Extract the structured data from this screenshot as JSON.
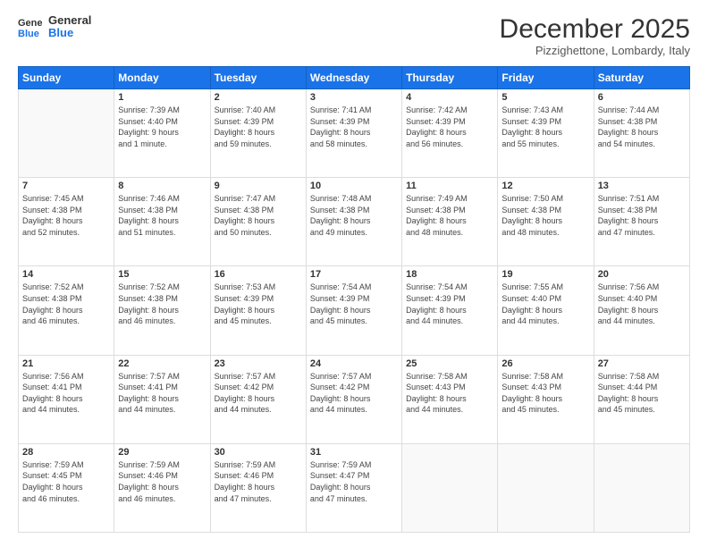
{
  "header": {
    "logo_line1": "General",
    "logo_line2": "Blue",
    "month_title": "December 2025",
    "subtitle": "Pizzighettone, Lombardy, Italy"
  },
  "days_of_week": [
    "Sunday",
    "Monday",
    "Tuesday",
    "Wednesday",
    "Thursday",
    "Friday",
    "Saturday"
  ],
  "weeks": [
    [
      {
        "num": "",
        "info": ""
      },
      {
        "num": "1",
        "info": "Sunrise: 7:39 AM\nSunset: 4:40 PM\nDaylight: 9 hours\nand 1 minute."
      },
      {
        "num": "2",
        "info": "Sunrise: 7:40 AM\nSunset: 4:39 PM\nDaylight: 8 hours\nand 59 minutes."
      },
      {
        "num": "3",
        "info": "Sunrise: 7:41 AM\nSunset: 4:39 PM\nDaylight: 8 hours\nand 58 minutes."
      },
      {
        "num": "4",
        "info": "Sunrise: 7:42 AM\nSunset: 4:39 PM\nDaylight: 8 hours\nand 56 minutes."
      },
      {
        "num": "5",
        "info": "Sunrise: 7:43 AM\nSunset: 4:39 PM\nDaylight: 8 hours\nand 55 minutes."
      },
      {
        "num": "6",
        "info": "Sunrise: 7:44 AM\nSunset: 4:38 PM\nDaylight: 8 hours\nand 54 minutes."
      }
    ],
    [
      {
        "num": "7",
        "info": "Sunrise: 7:45 AM\nSunset: 4:38 PM\nDaylight: 8 hours\nand 52 minutes."
      },
      {
        "num": "8",
        "info": "Sunrise: 7:46 AM\nSunset: 4:38 PM\nDaylight: 8 hours\nand 51 minutes."
      },
      {
        "num": "9",
        "info": "Sunrise: 7:47 AM\nSunset: 4:38 PM\nDaylight: 8 hours\nand 50 minutes."
      },
      {
        "num": "10",
        "info": "Sunrise: 7:48 AM\nSunset: 4:38 PM\nDaylight: 8 hours\nand 49 minutes."
      },
      {
        "num": "11",
        "info": "Sunrise: 7:49 AM\nSunset: 4:38 PM\nDaylight: 8 hours\nand 48 minutes."
      },
      {
        "num": "12",
        "info": "Sunrise: 7:50 AM\nSunset: 4:38 PM\nDaylight: 8 hours\nand 48 minutes."
      },
      {
        "num": "13",
        "info": "Sunrise: 7:51 AM\nSunset: 4:38 PM\nDaylight: 8 hours\nand 47 minutes."
      }
    ],
    [
      {
        "num": "14",
        "info": "Sunrise: 7:52 AM\nSunset: 4:38 PM\nDaylight: 8 hours\nand 46 minutes."
      },
      {
        "num": "15",
        "info": "Sunrise: 7:52 AM\nSunset: 4:38 PM\nDaylight: 8 hours\nand 46 minutes."
      },
      {
        "num": "16",
        "info": "Sunrise: 7:53 AM\nSunset: 4:39 PM\nDaylight: 8 hours\nand 45 minutes."
      },
      {
        "num": "17",
        "info": "Sunrise: 7:54 AM\nSunset: 4:39 PM\nDaylight: 8 hours\nand 45 minutes."
      },
      {
        "num": "18",
        "info": "Sunrise: 7:54 AM\nSunset: 4:39 PM\nDaylight: 8 hours\nand 44 minutes."
      },
      {
        "num": "19",
        "info": "Sunrise: 7:55 AM\nSunset: 4:40 PM\nDaylight: 8 hours\nand 44 minutes."
      },
      {
        "num": "20",
        "info": "Sunrise: 7:56 AM\nSunset: 4:40 PM\nDaylight: 8 hours\nand 44 minutes."
      }
    ],
    [
      {
        "num": "21",
        "info": "Sunrise: 7:56 AM\nSunset: 4:41 PM\nDaylight: 8 hours\nand 44 minutes."
      },
      {
        "num": "22",
        "info": "Sunrise: 7:57 AM\nSunset: 4:41 PM\nDaylight: 8 hours\nand 44 minutes."
      },
      {
        "num": "23",
        "info": "Sunrise: 7:57 AM\nSunset: 4:42 PM\nDaylight: 8 hours\nand 44 minutes."
      },
      {
        "num": "24",
        "info": "Sunrise: 7:57 AM\nSunset: 4:42 PM\nDaylight: 8 hours\nand 44 minutes."
      },
      {
        "num": "25",
        "info": "Sunrise: 7:58 AM\nSunset: 4:43 PM\nDaylight: 8 hours\nand 44 minutes."
      },
      {
        "num": "26",
        "info": "Sunrise: 7:58 AM\nSunset: 4:43 PM\nDaylight: 8 hours\nand 45 minutes."
      },
      {
        "num": "27",
        "info": "Sunrise: 7:58 AM\nSunset: 4:44 PM\nDaylight: 8 hours\nand 45 minutes."
      }
    ],
    [
      {
        "num": "28",
        "info": "Sunrise: 7:59 AM\nSunset: 4:45 PM\nDaylight: 8 hours\nand 46 minutes."
      },
      {
        "num": "29",
        "info": "Sunrise: 7:59 AM\nSunset: 4:46 PM\nDaylight: 8 hours\nand 46 minutes."
      },
      {
        "num": "30",
        "info": "Sunrise: 7:59 AM\nSunset: 4:46 PM\nDaylight: 8 hours\nand 47 minutes."
      },
      {
        "num": "31",
        "info": "Sunrise: 7:59 AM\nSunset: 4:47 PM\nDaylight: 8 hours\nand 47 minutes."
      },
      {
        "num": "",
        "info": ""
      },
      {
        "num": "",
        "info": ""
      },
      {
        "num": "",
        "info": ""
      }
    ]
  ]
}
